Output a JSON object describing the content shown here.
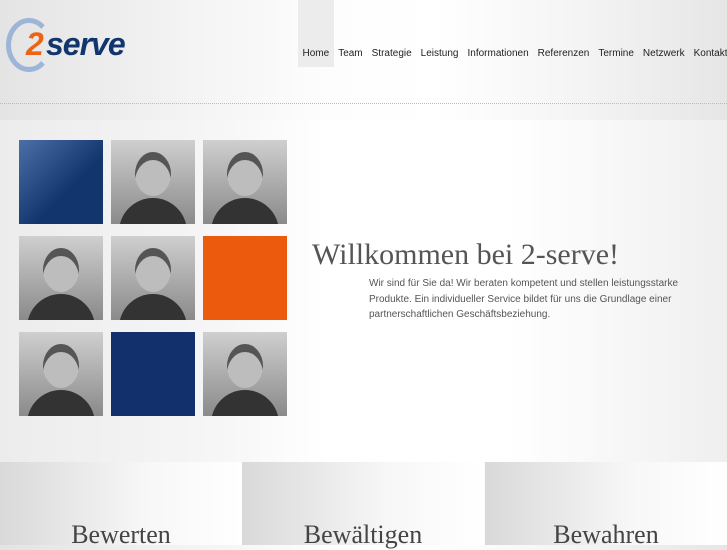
{
  "brand": {
    "logo_number": "2",
    "logo_word": "serve",
    "logo_colors": {
      "ring": "#9db5d6",
      "number": "#ee6414",
      "word": "#12356e"
    }
  },
  "nav": {
    "items": [
      {
        "label": "Home",
        "active": true
      },
      {
        "label": "Team"
      },
      {
        "label": "Strategie"
      },
      {
        "label": "Leistung"
      },
      {
        "label": "Informationen"
      },
      {
        "label": "Referenzen"
      },
      {
        "label": "Termine"
      },
      {
        "label": "Netzwerk"
      },
      {
        "label": "Kontakt"
      }
    ]
  },
  "main": {
    "title": "Willkommen bei 2-serve!",
    "intro": "Wir sind für Sie da! Wir beraten kompetent und stellen leistungsstarke Produkte. Ein individueller Service bildet für uns die Grundlage einer partnerschaftlichen Geschäftsbeziehung.",
    "tiles": [
      "blue-gradient",
      "photo",
      "photo",
      "photo",
      "photo",
      "orange",
      "photo",
      "navy",
      "photo"
    ],
    "accent_colors": {
      "orange": "#ec5a0d",
      "navy": "#12306b"
    }
  },
  "panels": [
    {
      "title": "Bewerten"
    },
    {
      "title": "Bewältigen"
    },
    {
      "title": "Bewahren"
    }
  ]
}
